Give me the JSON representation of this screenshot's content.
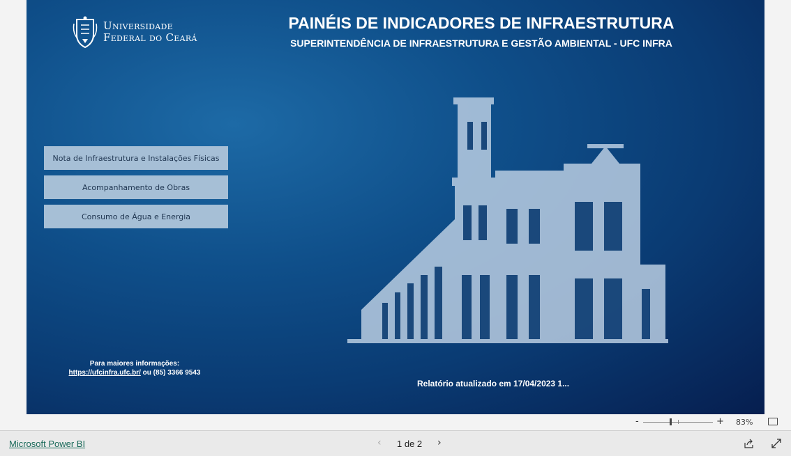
{
  "report": {
    "logo": {
      "line1": "Universidade",
      "line2": "Federal do Ceará"
    },
    "title": "PAINÉIS DE INDICADORES DE INFRAESTRUTURA",
    "subtitle": "SUPERINTENDÊNCIA DE INFRAESTRUTURA E GESTÃO AMBIENTAL - UFC INFRA",
    "nav_buttons": [
      {
        "label": "Nota de Infraestrutura e Instalações Físicas"
      },
      {
        "label": "Acompanhamento de Obras"
      },
      {
        "label": "Consumo de Água e Energia"
      }
    ],
    "info": {
      "heading": "Para maiores informações:",
      "link": "https://ufcinfra.ufc.br/",
      "contact": " ou (85) 3366 9543"
    },
    "updated": "Relatório atualizado em 17/04/2023 1..."
  },
  "zoom": {
    "minus": "-",
    "plus": "+",
    "percent": "83%"
  },
  "footer": {
    "powerbi_link": "Microsoft Power BI",
    "page_indicator": "1 de 2",
    "prev": "‹",
    "next": "›"
  }
}
